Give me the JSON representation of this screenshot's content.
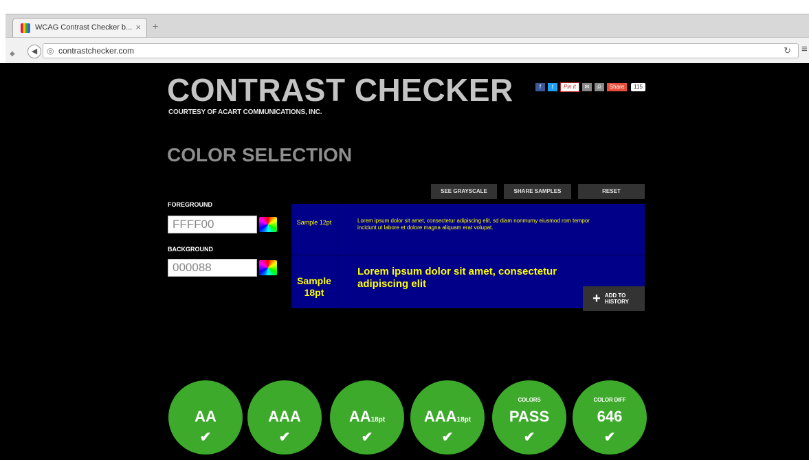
{
  "browser": {
    "tab_title": "WCAG Contrast Checker b...",
    "tab_close": "×",
    "new_tab": "+",
    "url": "contrastchecker.com",
    "back": "◀",
    "reload": "↻",
    "menu": "≡"
  },
  "header": {
    "title": "CONTRAST CHECKER",
    "courtesy": "COURTESY OF ACART COMMUNICATIONS, INC.",
    "social": {
      "facebook": "f",
      "twitter": "t",
      "pinterest": "Pin it",
      "share": "Share",
      "share_count": "115"
    }
  },
  "section": {
    "title": "COLOR SELECTION"
  },
  "actions": {
    "see_grayscale": "SEE GRAYSCALE",
    "share_samples": "SHARE SAMPLES",
    "reset": "RESET"
  },
  "form": {
    "foreground_label": "FOREGROUND",
    "foreground_value": "FFFF00",
    "background_label": "BACKGROUND",
    "background_value": "000088"
  },
  "samples": {
    "small_label": "Sample 12pt",
    "small_text": "Lorem ipsum dolor sit amet, consectetur adipiscing elit, sd diam nonmumy eiusmod rom tempor incidunt ut labore et dolore magna aliquam erat volupat.",
    "large_label": "Sample 18pt",
    "large_text": "Lorem ipsum dolor sit amet, consectetur adipiscing elit",
    "add_to_history": "ADD TO HISTORY",
    "foreground_color": "#ffff00",
    "background_color": "#000088"
  },
  "results": {
    "aa": "AA",
    "aaa": "AAA",
    "aa18": "AA",
    "aaa18": "AAA",
    "size_suffix": "18pt",
    "colors_caption": "COLORS",
    "colors_value": "PASS",
    "diff_caption": "COLOR DIFF",
    "diff_value": "646",
    "check": "✔",
    "pass_color": "#3daa2b"
  }
}
